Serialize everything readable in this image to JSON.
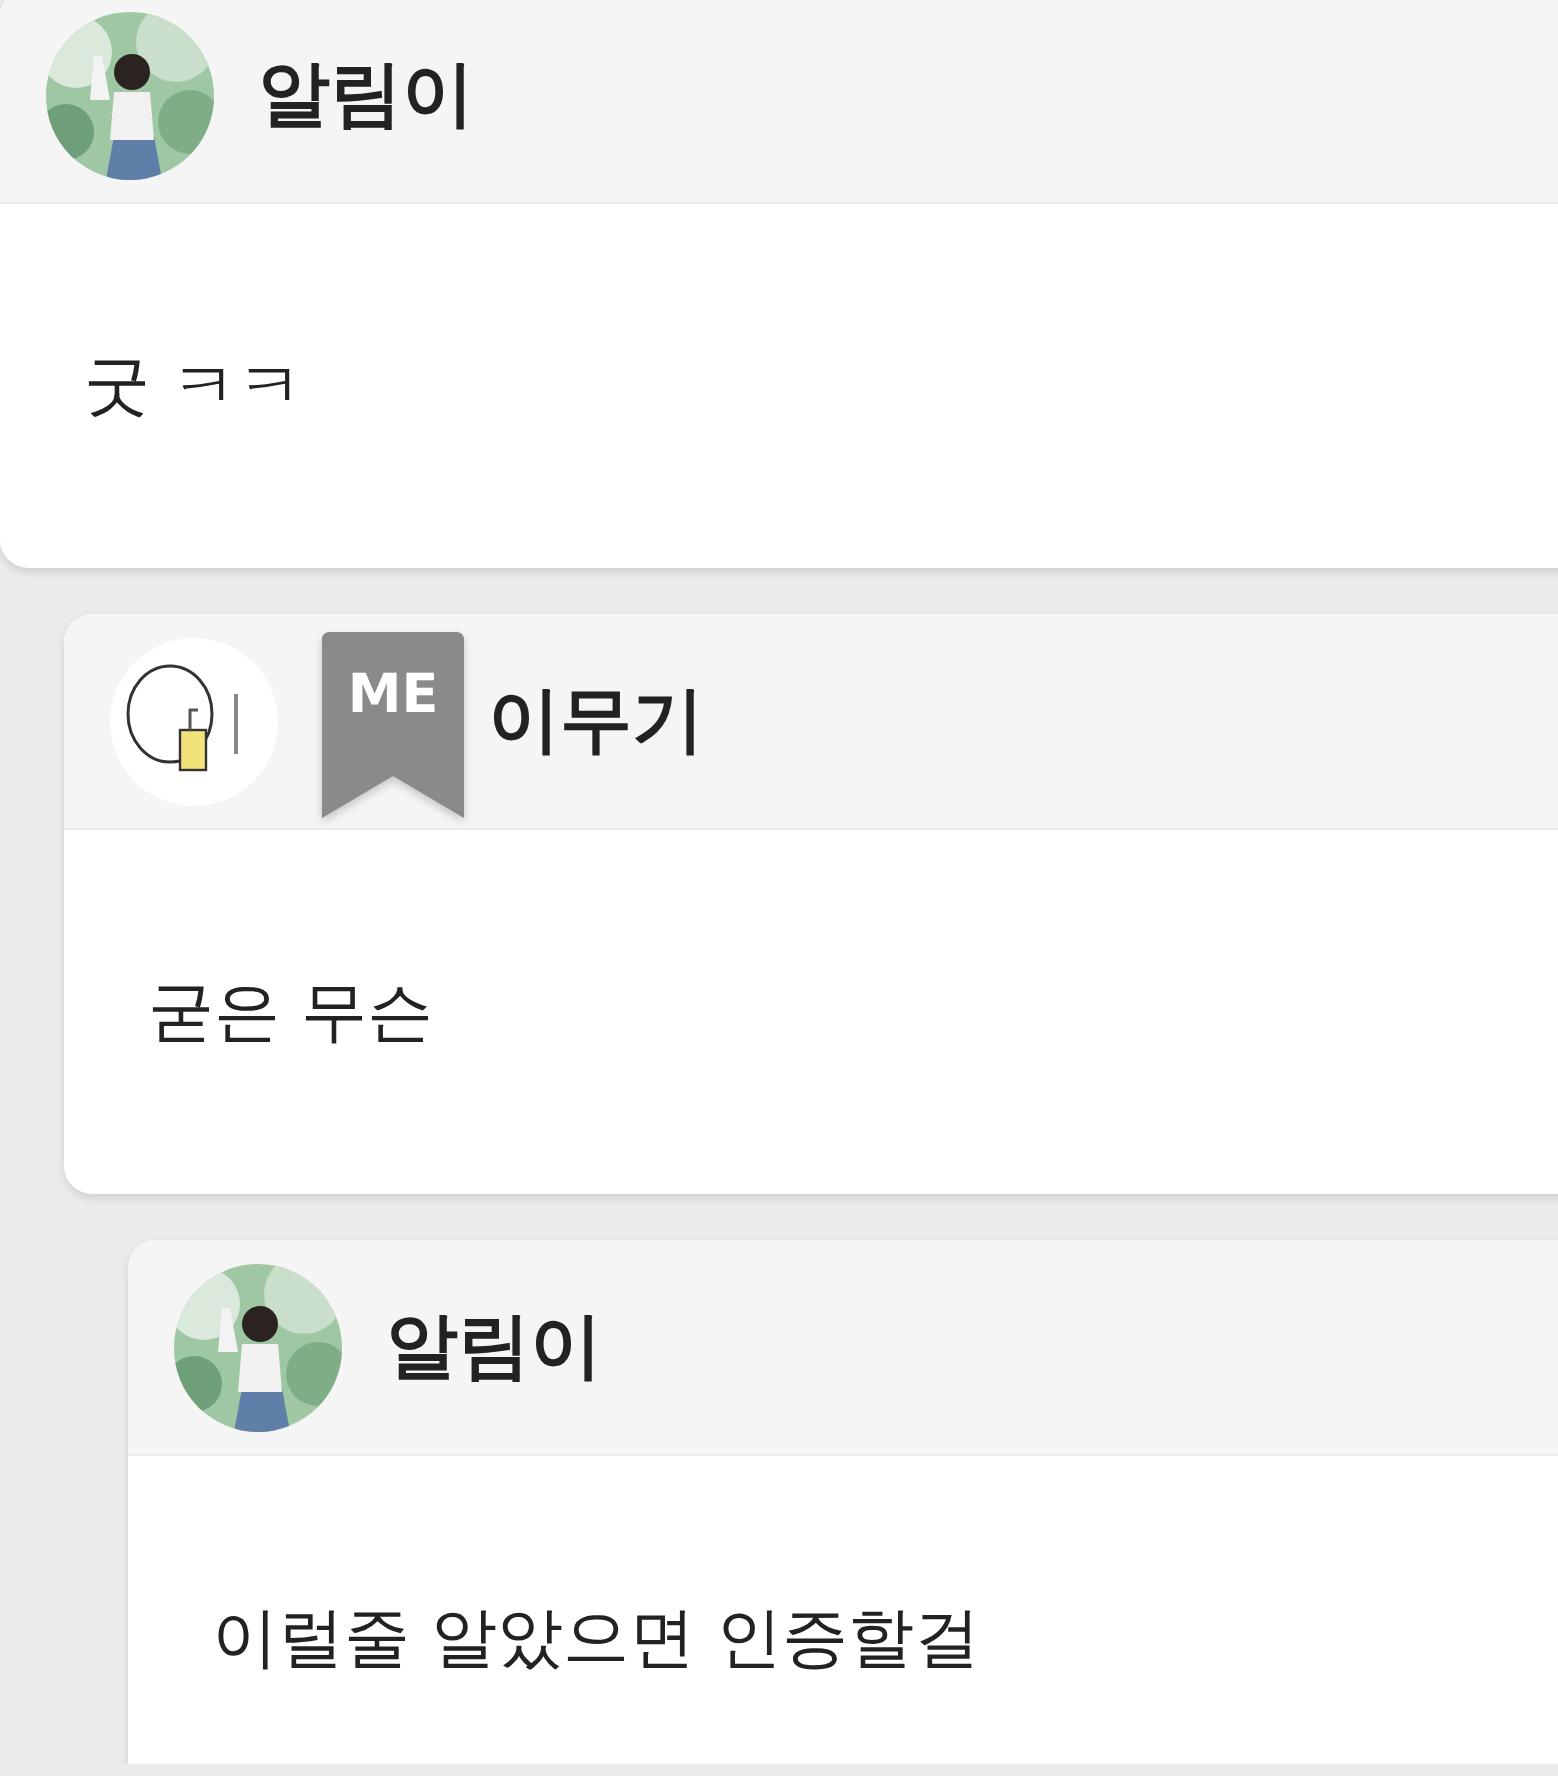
{
  "comments": [
    {
      "author": "알림이",
      "text": "굿 ㅋㅋ",
      "children": [
        {
          "author": "이무기",
          "badge": "ME",
          "text": "굳은 무슨",
          "children": [
            {
              "author": "알림이",
              "text": "이럴줄 알았으면 인증할걸"
            }
          ]
        }
      ]
    }
  ]
}
